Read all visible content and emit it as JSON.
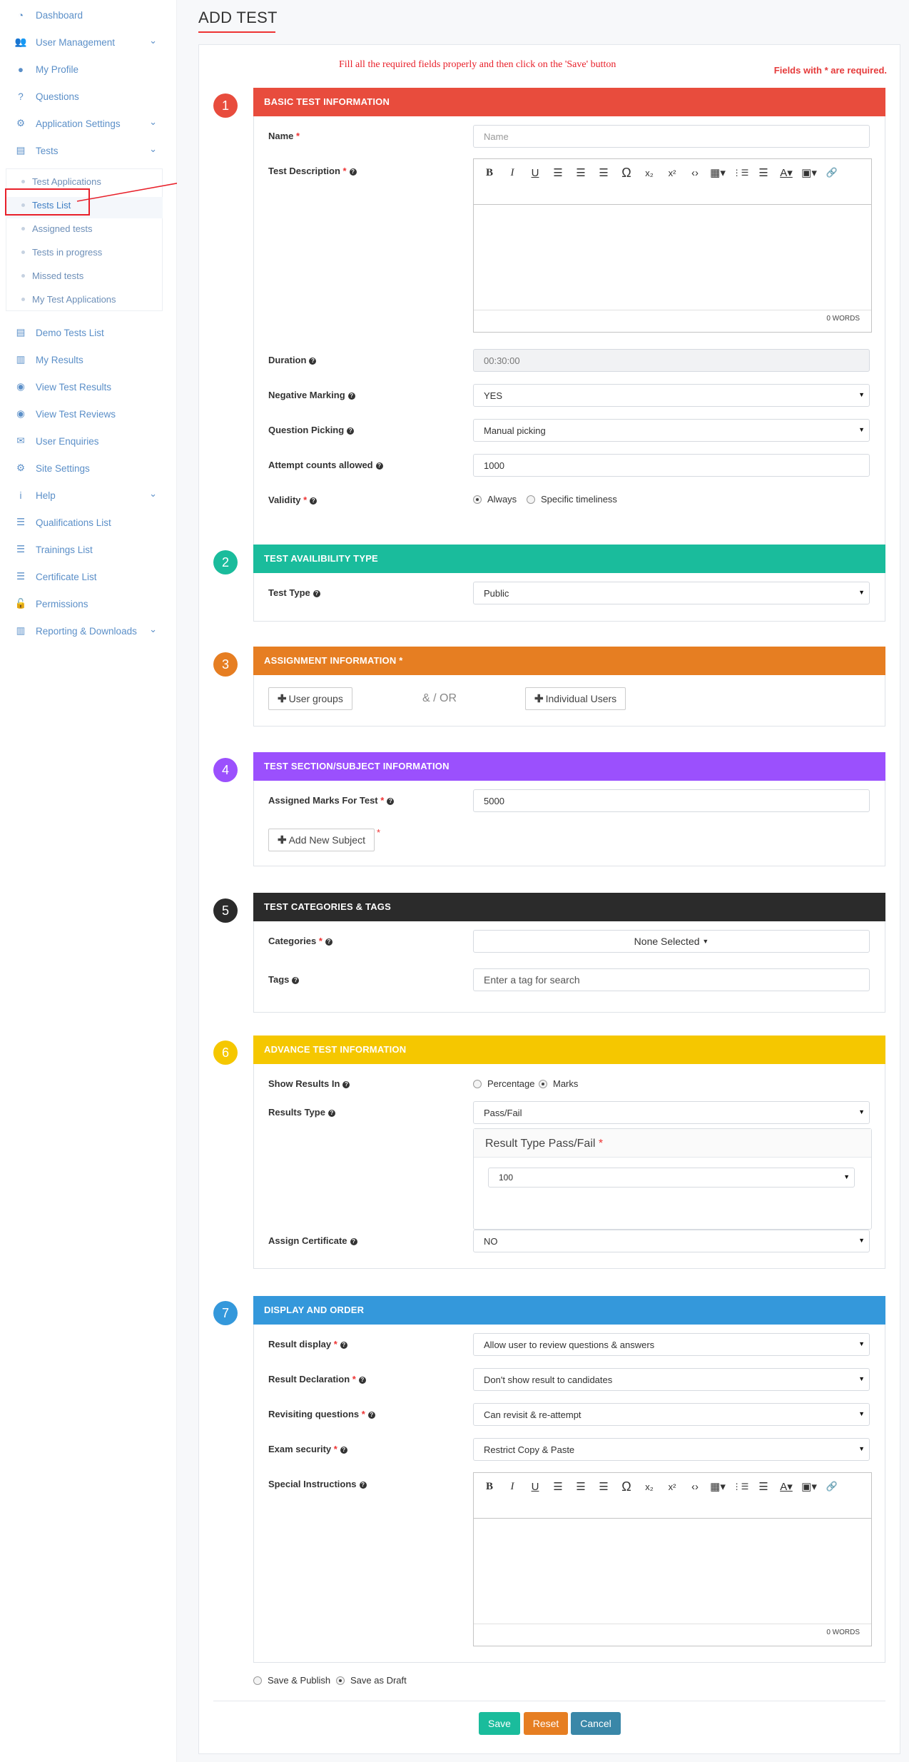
{
  "sidebar": {
    "items": [
      {
        "label": "Dashboard",
        "icon": "dashboard-icon"
      },
      {
        "label": "User Management",
        "icon": "users-icon",
        "chevron": true
      },
      {
        "label": "My Profile",
        "icon": "user-icon"
      },
      {
        "label": "Questions",
        "icon": "question-icon"
      },
      {
        "label": "Application Settings",
        "icon": "gear-icon",
        "chevron": true
      },
      {
        "label": "Tests",
        "icon": "document-icon",
        "chevron": true
      }
    ],
    "sub_items": [
      "Test Applications",
      "Tests List",
      "Assigned tests",
      "Tests in progress",
      "Missed tests",
      "My Test Applications"
    ],
    "items_after": [
      {
        "label": "Demo Tests List",
        "icon": "document-icon"
      },
      {
        "label": "My Results",
        "icon": "bar-chart-icon"
      },
      {
        "label": "View Test Results",
        "icon": "eye-icon"
      },
      {
        "label": "View Test Reviews",
        "icon": "eye-icon"
      },
      {
        "label": "User Enquiries",
        "icon": "envelope-icon"
      },
      {
        "label": "Site Settings",
        "icon": "gears-icon"
      },
      {
        "label": "Help",
        "icon": "info-icon",
        "chevron": true
      },
      {
        "label": "Qualifications List",
        "icon": "list-icon"
      },
      {
        "label": "Trainings List",
        "icon": "list-icon"
      },
      {
        "label": "Certificate List",
        "icon": "list-icon"
      },
      {
        "label": "Permissions",
        "icon": "unlock-icon"
      },
      {
        "label": "Reporting & Downloads",
        "icon": "bar-chart-icon",
        "chevron": true
      }
    ]
  },
  "page": {
    "title": "ADD TEST",
    "notice": "Fill all the required fields properly and then click on the 'Save' button",
    "required_note": "Fields with * are required."
  },
  "sections": {
    "s1": {
      "num": "1",
      "title": "BASIC TEST INFORMATION",
      "color": "#e84c3d"
    },
    "s2": {
      "num": "2",
      "title": "TEST AVAILIBILITY TYPE",
      "color": "#1abc9c"
    },
    "s3": {
      "num": "3",
      "title": "ASSIGNMENT INFORMATION *",
      "color": "#e67e22"
    },
    "s4": {
      "num": "4",
      "title": "TEST SECTION/SUBJECT INFORMATION",
      "color": "#9b50fd"
    },
    "s5": {
      "num": "5",
      "title": "TEST CATEGORIES & TAGS",
      "color": "#2b2b2b"
    },
    "s6": {
      "num": "6",
      "title": "ADVANCE TEST INFORMATION",
      "color": "#f5c700"
    },
    "s7": {
      "num": "7",
      "title": "DISPLAY AND ORDER",
      "color": "#3498db"
    }
  },
  "basic": {
    "name_label": "Name",
    "name_placeholder": "Name",
    "desc_label": "Test Description",
    "desc_words": "0 WORDS",
    "duration_label": "Duration",
    "duration_value": "00:30:00",
    "negative_label": "Negative Marking",
    "negative_value": "YES",
    "picking_label": "Question Picking",
    "picking_value": "Manual picking",
    "attempts_label": "Attempt counts allowed",
    "attempts_value": "1000",
    "validity_label": "Validity",
    "validity_always": "Always",
    "validity_specific": "Specific timeliness"
  },
  "availability": {
    "type_label": "Test Type",
    "type_value": "Public"
  },
  "assignment": {
    "user_groups": "User groups",
    "and_or": "& / OR",
    "individual": "Individual Users"
  },
  "subject": {
    "marks_label": "Assigned Marks For Test",
    "marks_value": "5000",
    "add_subject": "Add New Subject"
  },
  "categories": {
    "categories_label": "Categories",
    "categories_value": "None Selected",
    "tags_label": "Tags",
    "tags_placeholder": "Enter a tag for search"
  },
  "advance": {
    "show_label": "Show Results In",
    "show_percentage": "Percentage",
    "show_marks": "Marks",
    "results_type_label": "Results Type",
    "results_type_value": "Pass/Fail",
    "passfail_title": "Result Type Pass/Fail",
    "passfail_value": "100",
    "certificate_label": "Assign Certificate",
    "certificate_value": "NO"
  },
  "display": {
    "result_display_label": "Result display",
    "result_display_value": "Allow user to review questions & answers",
    "declaration_label": "Result Declaration",
    "declaration_value": "Don't show result to candidates",
    "revisit_label": "Revisiting questions",
    "revisit_value": "Can revisit & re-attempt",
    "security_label": "Exam security",
    "security_value": "Restrict Copy & Paste",
    "instructions_label": "Special Instructions",
    "instructions_words": "0 WORDS"
  },
  "footer": {
    "publish": "Save & Publish",
    "draft": "Save as Draft",
    "save": "Save",
    "reset": "Reset",
    "cancel": "Cancel"
  },
  "toolbar": {
    "bold": "B",
    "italic": "I",
    "underline": "U",
    "omega": "Ω",
    "sub": "x₂",
    "sup": "x²",
    "code": "<>",
    "text_color": "A",
    "bg_color": "A"
  },
  "colors": {
    "accent": "#5b8fc8",
    "save": "#1abc9c",
    "reset": "#e67e22",
    "cancel": "#3a87a8"
  }
}
